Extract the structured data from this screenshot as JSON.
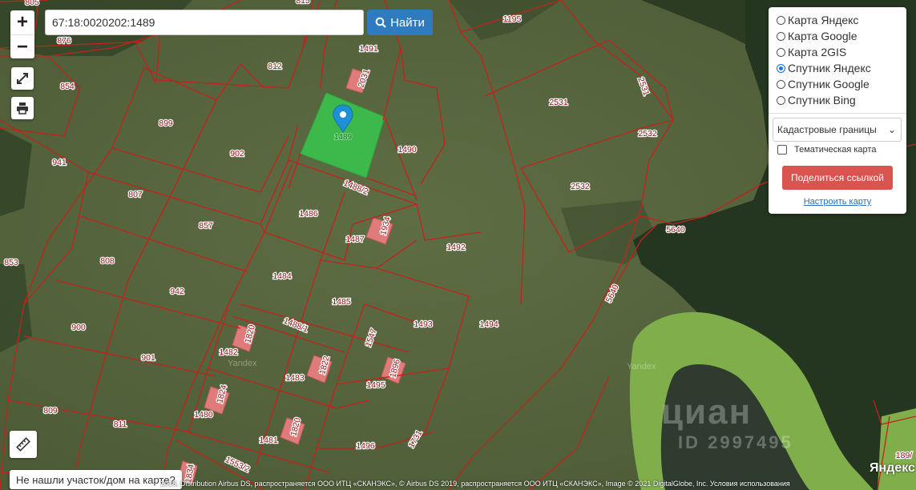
{
  "search": {
    "value": "67:18:0020202:1489",
    "button_label": "Найти"
  },
  "zoom": {
    "in_label": "+",
    "out_label": "−"
  },
  "layers": [
    {
      "label": "Карта Яндекс",
      "selected": false
    },
    {
      "label": "Карта Google",
      "selected": false
    },
    {
      "label": "Карта 2GIS",
      "selected": false
    },
    {
      "label": "Спутник Яндекс",
      "selected": true
    },
    {
      "label": "Спутник Google",
      "selected": false
    },
    {
      "label": "Спутник Bing",
      "selected": false
    }
  ],
  "overlay_select": {
    "value": "Кадастровые границы"
  },
  "thematic_map": {
    "label": "Тематическая карта",
    "checked": false
  },
  "share_button": "Поделиться ссылкой",
  "configure_link": "Настроить карту",
  "not_found_button": "Не нашли участок/дом на карте?",
  "selected_parcel": "1489",
  "parcel_labels": {
    "p805": "805",
    "p876": "876",
    "p815": "815",
    "p1195": "1195",
    "p1491": "1491",
    "p812": "812",
    "p854": "854",
    "p2031": "2031",
    "p2531a": "2531",
    "p2531b": "2531",
    "p899": "899",
    "p1490": "1490",
    "p2532a": "2532",
    "p2532b": "2532",
    "p902": "902",
    "p941": "941",
    "p1488_2": "1488/2",
    "p807": "807",
    "p1486": "1486",
    "p857": "857",
    "p1934": "1934",
    "p1487": "1487",
    "p5640a": "5640",
    "p853": "853",
    "p808": "808",
    "p1492": "1492",
    "p1484": "1484",
    "p5640b": "5640",
    "p942": "942",
    "p1485": "1485",
    "p900": "900",
    "p1488_1": "1488/1",
    "p1820a": "1820",
    "p1493": "1493",
    "p1494": "1494",
    "p1547": "1547",
    "p1482": "1482",
    "p901": "901",
    "p1822": "1822",
    "p1896": "1896",
    "p1483": "1483",
    "p1495": "1495",
    "p1824a": "1824",
    "p809": "809",
    "p1480": "1480",
    "p811": "811",
    "p1820b": "1820",
    "p1481": "1481",
    "p1496": "1496",
    "p1731": "1731",
    "p1553_2": "1553/2",
    "p1834": "1834",
    "p189": "189/"
  },
  "map_watermarks": {
    "yandex1": "Yandex",
    "yandex2": "Yandex"
  },
  "cian_watermark": {
    "logo": "циан",
    "id": "ID 2997495"
  },
  "copyright": "2018, Distribution Airbus DS, распространяется ООО ИТЦ «СКАНЭКС», © Airbus DS 2019, распространяется ООО ИТЦ «СКАНЭКС», Image © 2021 DigitalGlobe, Inc. Условия использования",
  "yandex_logo": "Яндекс"
}
